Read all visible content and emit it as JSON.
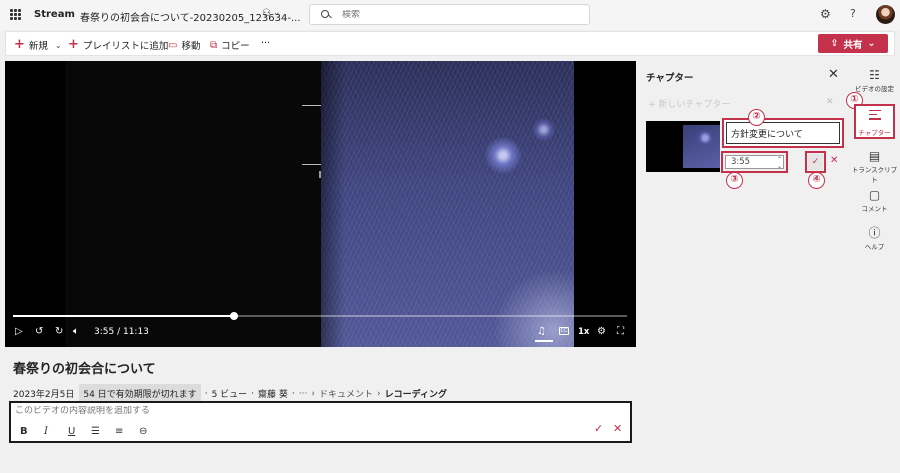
{
  "topbar": {
    "app_name": "Stream",
    "doc_title": "春祭りの初会合について-20230205_123634-...",
    "search_placeholder": "検索"
  },
  "toolbar": {
    "new_label": "新規",
    "add_playlist_label": "プレイリストに追加",
    "move_label": "移動",
    "copy_label": "コピー",
    "more_label": "···",
    "share_label": "共有"
  },
  "player": {
    "time_label": "3:55 / 11:13",
    "progress": 0.36,
    "speed_label": "1x",
    "cc_label": "CC"
  },
  "video": {
    "title": "春祭りの初会合について",
    "date": "2023年2月5日",
    "expire_badge": "54 日で有効期限が切れます",
    "views": "5 ビュー",
    "author": "齋藤 葵",
    "more": "···",
    "breadcrumb": [
      "ドキュメント",
      "レコーディング"
    ],
    "description_placeholder": "このビデオの内容説明を追加する"
  },
  "chapters": {
    "panel_title": "チャプター",
    "new_chapter_placeholder": "新しいチャプター",
    "chapter_title_value": "方針変更について",
    "chapter_time_value": "3:55"
  },
  "callouts": [
    "①",
    "②",
    "③",
    "④"
  ],
  "rail": {
    "video_settings_label": "ビデオの設定",
    "chapters_label": "チャプター",
    "transcript_label": "トランスクリプト",
    "comments_label": "コメント",
    "help_label": "ヘルプ"
  },
  "colors": {
    "accent": "#c4314b",
    "video_bg": "#000000",
    "page_bg": "#f0f0f0"
  }
}
